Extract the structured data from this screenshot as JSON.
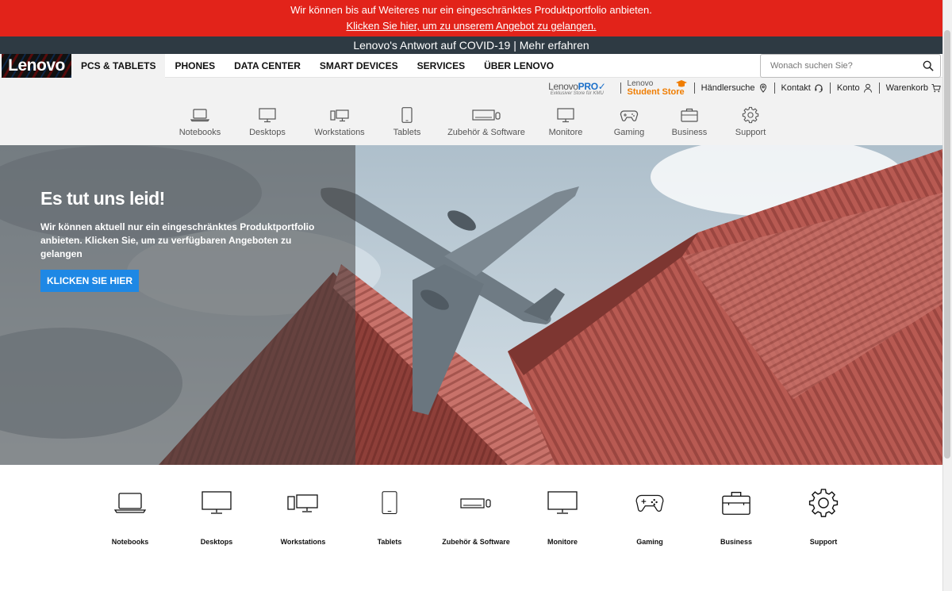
{
  "alert": {
    "message": "Wir können bis auf Weiteres nur ein eingeschränktes Produktportfolio anbieten.",
    "link": "Klicken Sie hier, um zu unserem Angebot zu gelangen."
  },
  "covid_banner": "Lenovo's Antwort auf COVID-19 | Mehr erfahren",
  "logo": "Lenovo",
  "nav": [
    {
      "label": "PCS & TABLETS",
      "active": true
    },
    {
      "label": "PHONES"
    },
    {
      "label": "DATA CENTER"
    },
    {
      "label": "SMART DEVICES"
    },
    {
      "label": "SERVICES"
    },
    {
      "label": "ÜBER LENOVO"
    }
  ],
  "search": {
    "placeholder": "Wonach suchen Sie?"
  },
  "utility": {
    "pro_brand": "Lenovo",
    "pro_suffix": "PRO",
    "pro_sub": "Exklusiver Store für KMU",
    "student_brand": "Lenovo",
    "student_store": "Student Store",
    "dealer": "Händlersuche",
    "contact": "Kontakt",
    "account": "Konto",
    "cart": "Warenkorb"
  },
  "categories": [
    {
      "label": "Notebooks",
      "icon": "laptop-icon"
    },
    {
      "label": "Desktops",
      "icon": "desktop-icon"
    },
    {
      "label": "Workstations",
      "icon": "workstation-icon"
    },
    {
      "label": "Tablets",
      "icon": "tablet-icon"
    },
    {
      "label": "Zubehör & Software",
      "icon": "accessories-icon"
    },
    {
      "label": "Monitore",
      "icon": "monitor-icon"
    },
    {
      "label": "Gaming",
      "icon": "gamepad-icon"
    },
    {
      "label": "Business",
      "icon": "briefcase-icon"
    },
    {
      "label": "Support",
      "icon": "gear-icon"
    }
  ],
  "hero": {
    "title": "Es tut uns leid!",
    "body": "Wir können aktuell nur ein eingeschränktes Produktportfolio anbieten. Klicken Sie, um zu verfügbaren Angeboten zu gelangen",
    "button": "KLICKEN SIE HIER"
  },
  "colors": {
    "alert_red": "#e2231a",
    "covid_bar": "#2e3a43",
    "button_blue": "#1e88e5",
    "student_orange": "#f07d00",
    "pro_blue": "#1a6fc9"
  }
}
